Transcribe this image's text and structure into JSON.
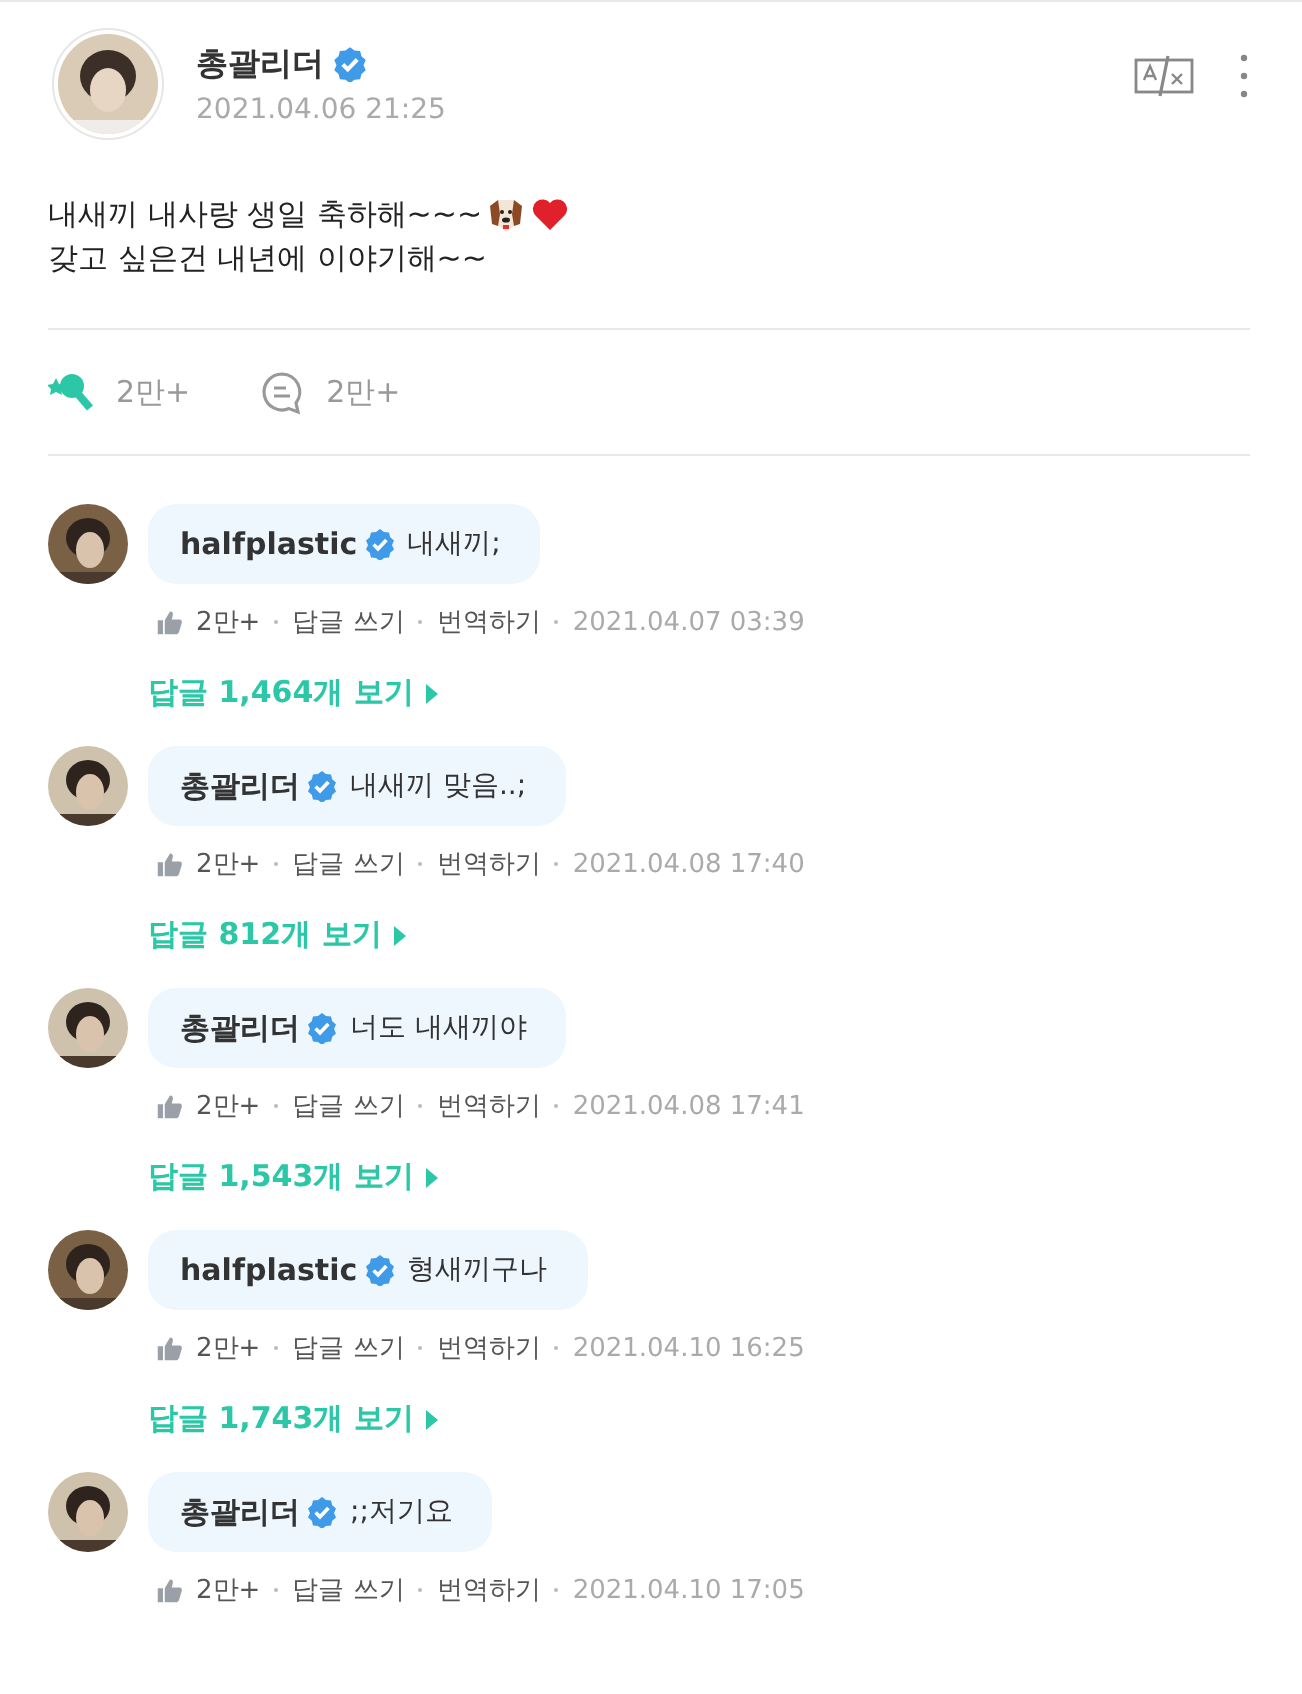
{
  "post": {
    "author": "총괄리더",
    "verified": true,
    "time": "2021.04.06 21:25",
    "lines": [
      "내새끼 내사랑 생일 축하해~~~",
      "갖고 싶은건 내년에 이야기해~~"
    ],
    "emojis": [
      {
        "kind": "dog"
      },
      {
        "kind": "heart"
      }
    ],
    "likes": "2만+",
    "comments": "2만+"
  },
  "comments": [
    {
      "author": "halfplastic",
      "verified": true,
      "text": "내새끼;",
      "likes": "2만+",
      "reply": "답글 쓰기",
      "translate": "번역하기",
      "time": "2021.04.07 03:39",
      "replies": "답글 1,464개 보기"
    },
    {
      "author": "총괄리더",
      "verified": true,
      "text": "내새끼 맞음..;",
      "likes": "2만+",
      "reply": "답글 쓰기",
      "translate": "번역하기",
      "time": "2021.04.08 17:40",
      "replies": "답글 812개 보기"
    },
    {
      "author": "총괄리더",
      "verified": true,
      "text": "너도 내새끼야",
      "likes": "2만+",
      "reply": "답글 쓰기",
      "translate": "번역하기",
      "time": "2021.04.08 17:41",
      "replies": "답글 1,543개 보기"
    },
    {
      "author": "halfplastic",
      "verified": true,
      "text": "형새끼구나",
      "likes": "2만+",
      "reply": "답글 쓰기",
      "translate": "번역하기",
      "time": "2021.04.10 16:25",
      "replies": "답글 1,743개 보기"
    },
    {
      "author": "총괄리더",
      "verified": true,
      "text": ";;저기요",
      "likes": "2만+",
      "reply": "답글 쓰기",
      "translate": "번역하기",
      "time": "2021.04.10 17:05"
    }
  ]
}
